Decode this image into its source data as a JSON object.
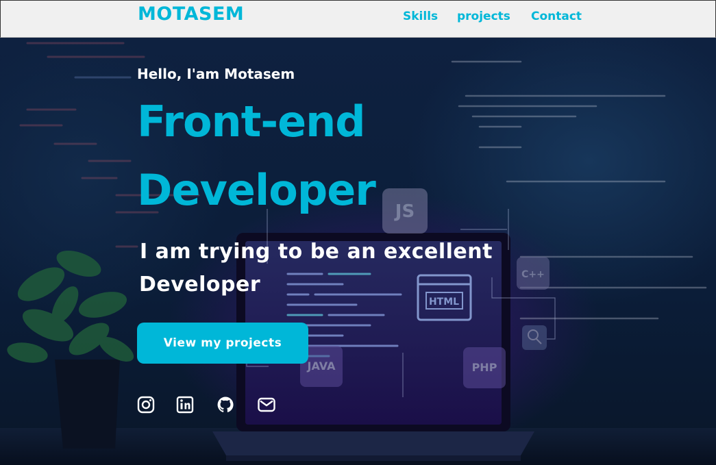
{
  "header": {
    "brand": "MOTASEM",
    "nav": [
      {
        "label": "Skills"
      },
      {
        "label": "projects"
      },
      {
        "label": "Contact"
      }
    ]
  },
  "hero": {
    "greeting": "Hello, I'am Motasem",
    "headline_line1": "Front-end",
    "headline_line2": "Developer",
    "tagline_line1": "I am trying to be an excellent",
    "tagline_line2": "Developer",
    "cta_label": "View my projects",
    "background_badges": [
      "JS",
      "C++",
      "JAVA",
      "PHP",
      "HTML"
    ]
  },
  "social": [
    {
      "icon": "instagram-icon"
    },
    {
      "icon": "linkedin-icon"
    },
    {
      "icon": "github-icon"
    },
    {
      "icon": "mail-icon"
    }
  ],
  "colors": {
    "accent": "#00b7d8",
    "nav_background": "#f0f0f0",
    "hero_text": "#ffffff"
  }
}
